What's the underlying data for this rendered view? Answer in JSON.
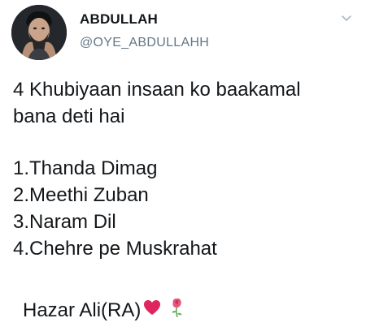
{
  "user": {
    "display_name": "ABDULLAH",
    "handle": "@OYE_ABDULLAHH",
    "avatar_icon": "profile-photo"
  },
  "tweet": {
    "intro_line_1": "4 Khubiyaan insaan ko baakamal",
    "intro_line_2": "bana deti hai",
    "items": [
      "1.Thanda Dimag",
      "2.Meethi Zuban",
      "3.Naram Dil",
      "4.Chehre pe Muskrahat"
    ],
    "signoff": "Hazar Ali(RA)",
    "emojis": [
      "red-heart-icon",
      "rose-icon"
    ]
  },
  "colors": {
    "text": "#14171a",
    "secondary": "#657786",
    "heart": "#e0245e",
    "rose": "#e8557a"
  },
  "menu": {
    "icon": "chevron-down-icon"
  }
}
